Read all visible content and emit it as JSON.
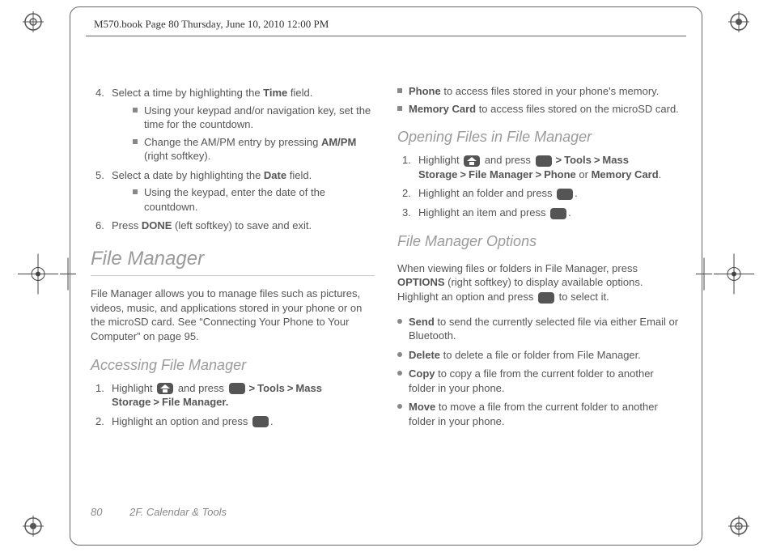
{
  "header": {
    "framemaker_line": "M570.book  Page 80  Thursday, June 10, 2010  12:00 PM"
  },
  "footer": {
    "page_number": "80",
    "section": "2F. Calendar & Tools"
  },
  "left": {
    "step4": {
      "text_a": "Select a time by highlighting the ",
      "bold_a": "Time",
      "text_b": " field.",
      "bul1": "Using your keypad and/or navigation key, set the time for the countdown.",
      "bul2_a": "Change the AM/PM entry by pressing ",
      "bul2_bold": "AM/PM",
      "bul2_b": " (right softkey)."
    },
    "step5": {
      "text_a": "Select a date by highlighting the ",
      "bold_a": "Date",
      "text_b": " field.",
      "bul1": "Using the keypad, enter the date of the countdown."
    },
    "step6": {
      "text_a": "Press ",
      "bold_a": "DONE",
      "text_b": " (left softkey) to save and exit."
    },
    "h1": "File Manager",
    "intro": "File Manager allows you to manage files such as pictures, videos, music, and applications stored in your phone or on the microSD card. See “Connecting Your Phone to Your Computer” on page 95.",
    "h2_access": "Accessing File Manager",
    "access_step1_a": "Highlight ",
    "access_step1_b": " and press ",
    "path_tools": "Tools",
    "path_mass": "Mass Storage",
    "path_fm": "File Manager.",
    "access_step2_a": "Highlight an option and press ",
    "access_step2_b": "."
  },
  "right": {
    "phone_label": "Phone",
    "phone_txt": " to access files stored in your phone's memory.",
    "mc_label": "Memory Card",
    "mc_txt": " to access files stored on the microSD card.",
    "h2_open": "Opening Files in File Manager",
    "open_step1_a": "Highlight ",
    "open_step1_b": " and press ",
    "path_tools": "Tools",
    "path_mass": "Mass Storage",
    "path_fm2": "File Manager",
    "path_phone": "Phone",
    "path_or": " or ",
    "path_mc": "Memory Card",
    "period": ".",
    "open_step2_a": "Highlight an folder and press ",
    "open_step3_a": "Highlight an item and press ",
    "h2_opts": "File Manager Options",
    "opts_intro_a": "When viewing files or folders in File Manager, press ",
    "opts_intro_bold": "OPTIONS",
    "opts_intro_b": " (right softkey) to display available options. Highlight an option and press ",
    "opts_intro_c": " to select it.",
    "send_b": "Send",
    "send_t": " to send the currently selected file via either Email or Bluetooth.",
    "del_b": "Delete",
    "del_t": " to delete a file or folder from File Manager.",
    "copy_b": "Copy",
    "copy_t": " to copy a file from the current folder to another folder in your phone.",
    "move_b": "Move",
    "move_t": " to move a file from the current folder to another folder in your phone."
  }
}
